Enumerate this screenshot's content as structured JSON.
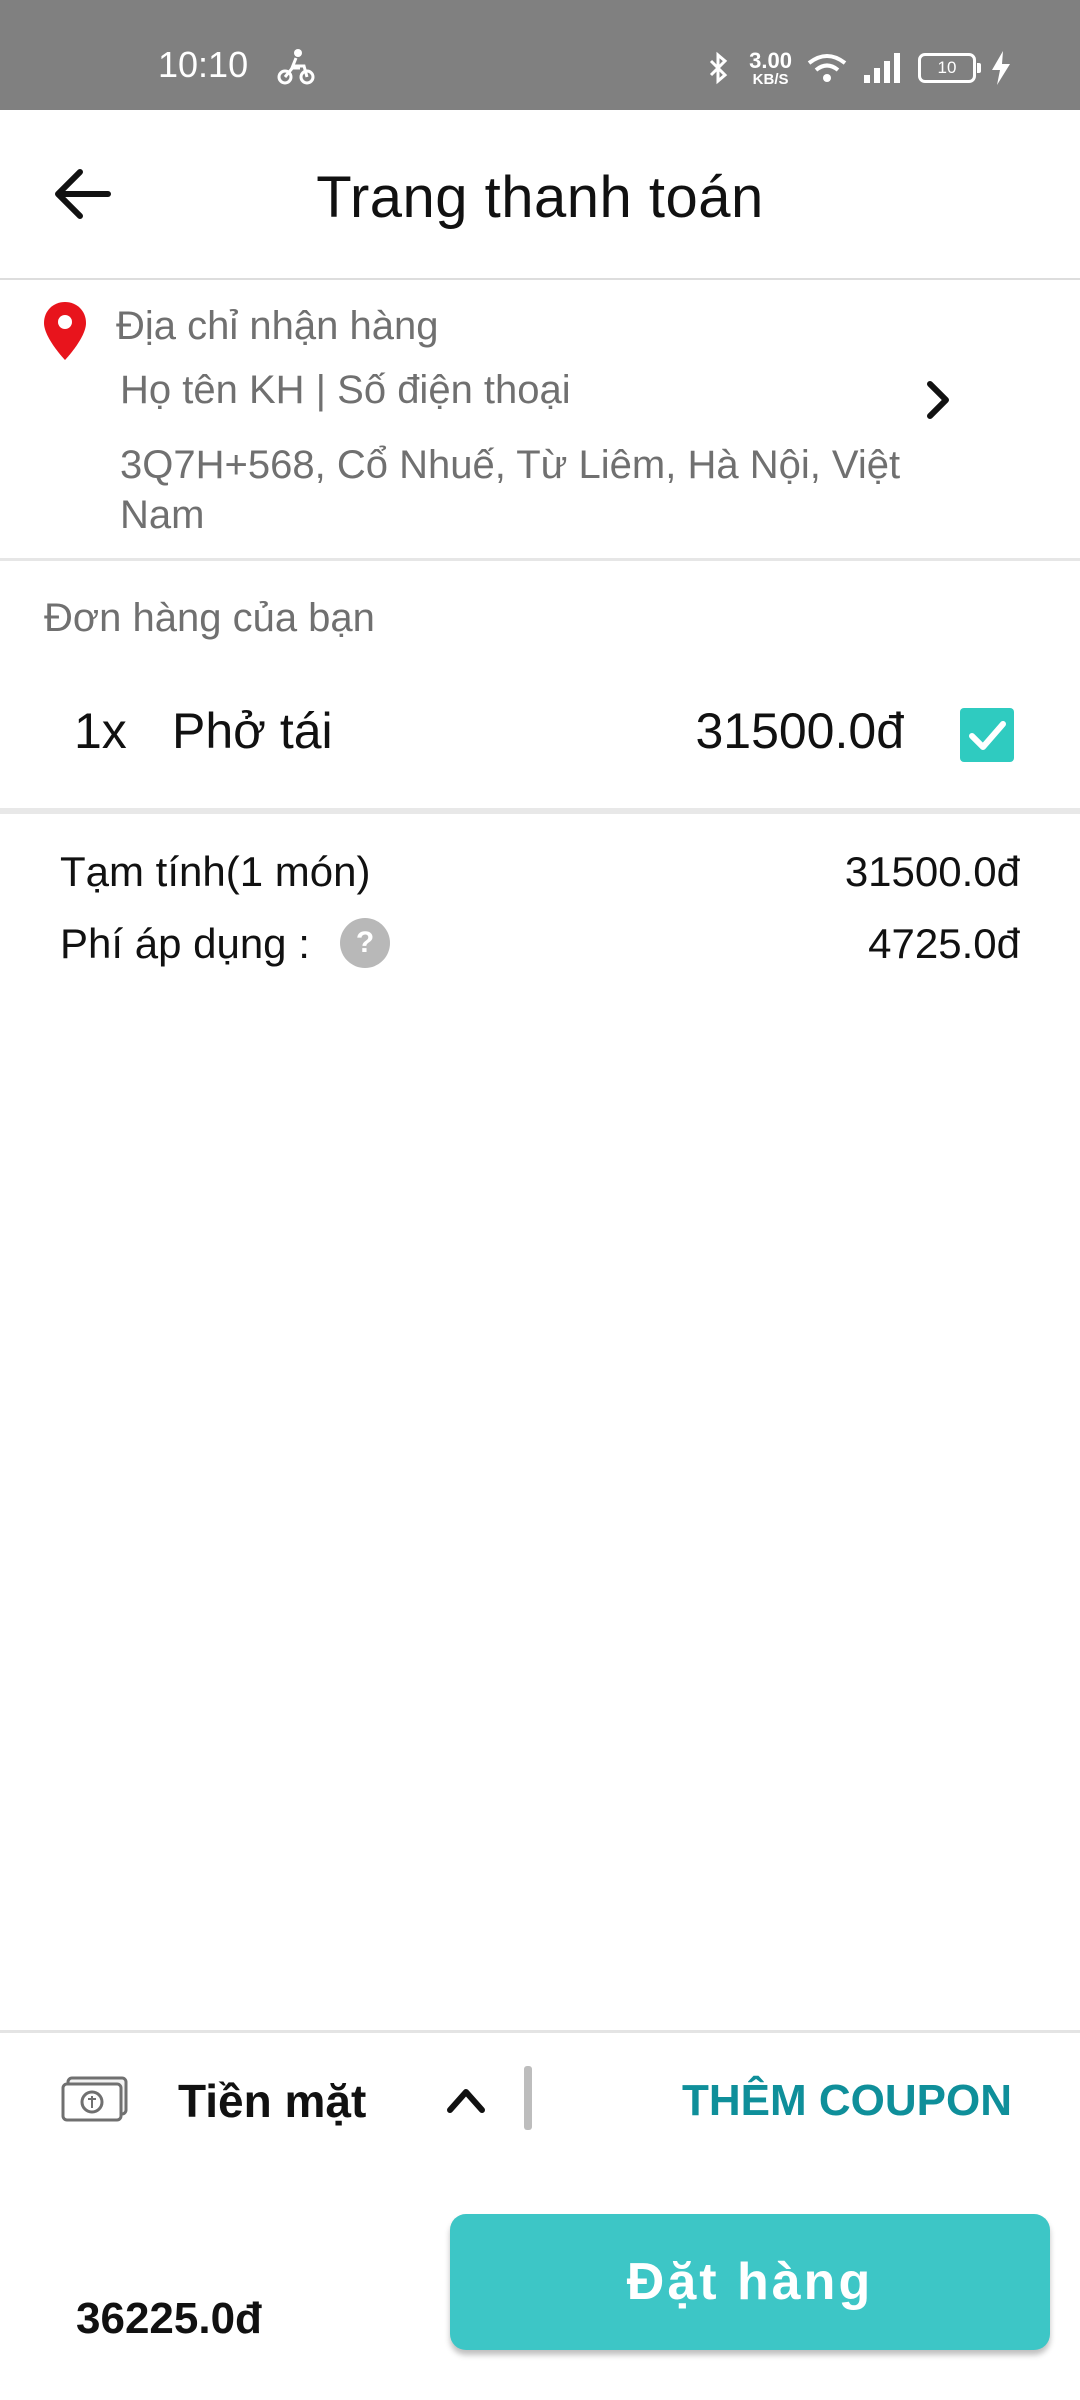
{
  "status_bar": {
    "time": "10:10",
    "net_speed_value": "3.00",
    "net_speed_unit": "KB/S",
    "battery_level": "10"
  },
  "header": {
    "title": "Trang thanh toán"
  },
  "address": {
    "heading": "Địa chỉ nhận hàng",
    "name_phone": "Họ tên KH | Số điện thoại",
    "text": "3Q7H+568, Cổ Nhuế, Từ Liêm, Hà Nội, Việt Nam"
  },
  "order": {
    "heading": "Đơn hàng của bạn",
    "items": [
      {
        "qty": "1x",
        "name": "Phở tái",
        "price": "31500.0đ",
        "checked": true
      }
    ]
  },
  "summary": {
    "subtotal_label": "Tạm tính(1 món)",
    "subtotal_value": "31500.0đ",
    "fee_label": "Phí áp dụng :",
    "fee_help": "?",
    "fee_value": "4725.0đ"
  },
  "footer": {
    "payment_method": "Tiền mặt",
    "coupon_label": "THÊM COUPON",
    "total": "36225.0đ",
    "order_button": "Đặt hàng"
  },
  "colors": {
    "accent": "#3dc6c6",
    "coupon_text": "#0f8f9a",
    "checkbox": "#2fcbc0",
    "pin": "#e8141c",
    "status_bar": "#808080"
  }
}
